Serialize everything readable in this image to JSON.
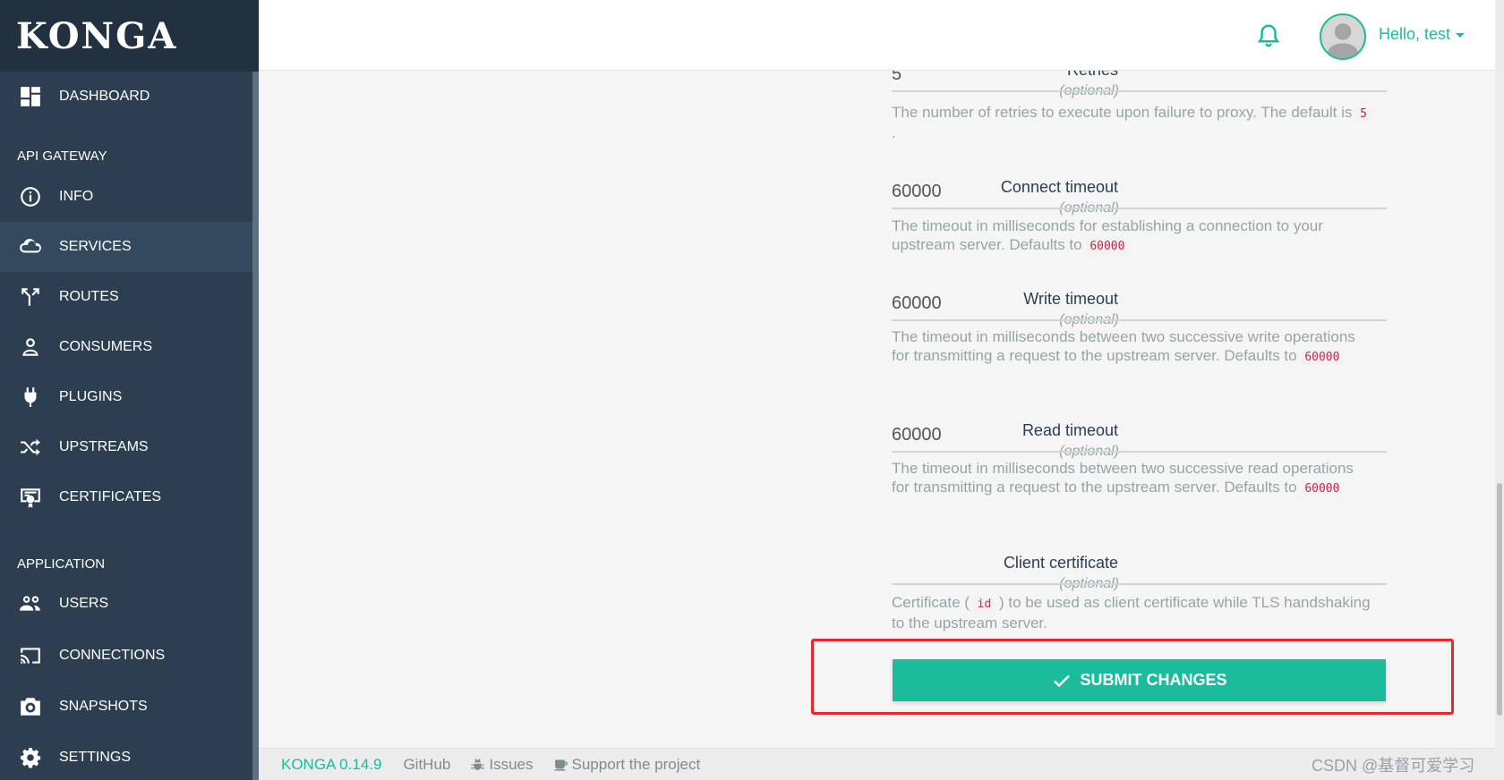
{
  "app": {
    "logo": "KONGA"
  },
  "sidebar": {
    "dashboard": "DASHBOARD",
    "section_gateway": "API GATEWAY",
    "gateway_items": [
      "INFO",
      "SERVICES",
      "ROUTES",
      "CONSUMERS",
      "PLUGINS",
      "UPSTREAMS",
      "CERTIFICATES"
    ],
    "section_application": "APPLICATION",
    "app_items": [
      "USERS",
      "CONNECTIONS",
      "SNAPSHOTS",
      "SETTINGS"
    ],
    "active_item": "SERVICES"
  },
  "header": {
    "user_greeting": "Hello, test",
    "notification_icon": "bell-icon",
    "accent_color": "#1abc9c"
  },
  "form": {
    "retries": {
      "label": "Retries",
      "optional": "(optional)",
      "value": "5",
      "help_prefix": "The number of retries to execute upon failure to proxy. The default is ",
      "help_code": "5",
      "help_suffix": " ."
    },
    "connect_timeout": {
      "label": "Connect timeout",
      "optional": "(optional)",
      "value": "60000",
      "help_prefix": "The timeout in milliseconds for establishing a connection to your upstream server. Defaults to ",
      "help_code": "60000"
    },
    "write_timeout": {
      "label": "Write timeout",
      "optional": "(optional)",
      "value": "60000",
      "help_prefix": "The timeout in milliseconds between two successive write operations for transmitting a request to the upstream server. Defaults to ",
      "help_code": "60000"
    },
    "read_timeout": {
      "label": "Read timeout",
      "optional": "(optional)",
      "value": "60000",
      "help_prefix": "The timeout in milliseconds between two successive read operations for transmitting a request to the upstream server. Defaults to ",
      "help_code": "60000"
    },
    "client_certificate": {
      "label": "Client certificate",
      "optional": "(optional)",
      "value": "",
      "help_prefix": "Certificate ( ",
      "help_code": "id",
      "help_suffix": " ) to be used as client certificate while TLS handshaking to the upstream server."
    },
    "submit_label": "SUBMIT CHANGES"
  },
  "footer": {
    "version": "KONGA 0.14.9",
    "github": "GitHub",
    "issues": "Issues",
    "support": "Support the project"
  },
  "watermark": "CSDN @基督可爱学习"
}
